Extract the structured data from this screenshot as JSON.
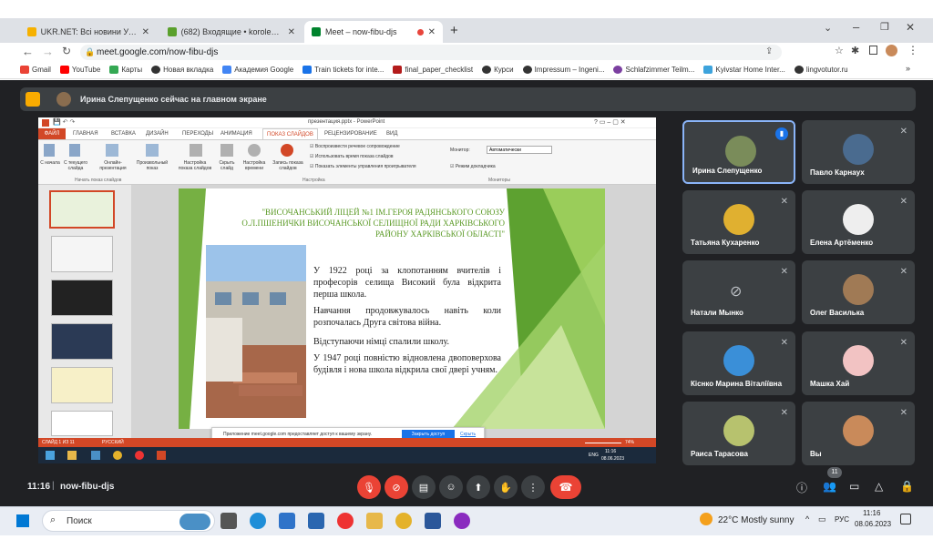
{
  "browser": {
    "tabs": [
      {
        "title": "UKR.NET: Всі новини України, о"
      },
      {
        "title": "(682) Входящие • koroleva-nv7!"
      },
      {
        "title": "Meet – now-fibu-djs"
      }
    ],
    "url": "meet.google.com/now-fibu-djs",
    "bookmarks": [
      "Gmail",
      "YouTube",
      "Карты",
      "Новая вкладка",
      "Академия Google",
      "Train tickets for inte...",
      "final_paper_checklist",
      "Курси",
      "Impressum – Ingeni...",
      "Schlafzimmer Teilm...",
      "Kyivstar Home Inter...",
      "lingvotutor.ru"
    ]
  },
  "meet": {
    "banner": "Ирина Слепущенко сейчас на главном экране",
    "meeting_time": "11:16",
    "meeting_code": "now-fibu-djs",
    "participants_count": "11",
    "participants": [
      {
        "name": "Ирина Слепущенко"
      },
      {
        "name": "Павло Карнаух"
      },
      {
        "name": "Татьяна Кухаренко"
      },
      {
        "name": "Елена Артёменко"
      },
      {
        "name": "Натали Мынко"
      },
      {
        "name": "Олег Василька"
      },
      {
        "name": "Кiснко Марина Віталіївна"
      },
      {
        "name": "Машка Хай"
      },
      {
        "name": "Раиса Тарасова"
      },
      {
        "name": "Вы"
      }
    ]
  },
  "ppt": {
    "title": "презентация.pptx - PowerPoint",
    "tabs": [
      "ФАЙЛ",
      "ГЛАВНАЯ",
      "ВСТАВКА",
      "ДИЗАЙН",
      "ПЕРЕХОДЫ",
      "АНИМАЦИЯ",
      "ПОКАЗ СЛАЙДОВ",
      "РЕЦЕНЗИРОВАНИЕ",
      "ВИД"
    ],
    "ribbon": {
      "btn1": "С начала",
      "btn2": "С текущего слайда",
      "btn3": "Онлайн-презентация",
      "btn4": "Произвольный показ",
      "group1": "Начать показ слайдов",
      "btn5": "Настройка показа слайдов",
      "btn6": "Скрыть слайд",
      "btn7": "Настройка времени",
      "btn8": "Запись показа слайдов",
      "group2": "Настройка",
      "chk1": "Воспроизвести речевое сопровождение",
      "chk2": "Использовать время показа слайдов",
      "chk3": "Показать элементы управления проигрывателя",
      "monitor_label": "Монитор:",
      "monitor_value": "Автоматически",
      "presenter": "Режим докладчика",
      "group3": "Мониторы"
    },
    "slide": {
      "heading": "\"ВИСОЧАНСЬКИЙ ЛІЦЕЙ №1 ІМ.ГЕРОЯ РАДЯНСЬКОГО СОЮЗУ О.Л.ПШЕНИЧКИ ВИСОЧАНСЬКОЇ СЕЛИЩНОЇ РАДИ ХАРКІВСЬКОГО РАЙОНУ ХАРКІВСЬКОЇ ОБЛАСТІ\"",
      "p1": "У 1922 році за клопотанням вчителів і професорів селища Високий була відкрита перша школа.",
      "p2": "Навчання продовжувалось навіть коли розпочалась Друга світова війна.",
      "p3": "Відступаючи німці спалили школу.",
      "p4": "У 1947 році повністю відновлена двоповерхова будівля і нова школа відкрила свої двері учням."
    },
    "status": "СЛАЙД 1 ИЗ 11",
    "lang": "РУССКИЙ",
    "zoom": "74%",
    "share_notice": "Приложение meet.google.com предоставляет доступ к вашему экрану.",
    "share_stop": "Закрыть доступ",
    "share_hide": "Скрыть",
    "inner_time": "11:16",
    "inner_date": "08.06.2023",
    "inner_lang": "ENG"
  },
  "taskbar": {
    "search": "Поиск",
    "weather": "22°C  Mostly sunny",
    "lang": "РУС",
    "time": "11:16",
    "date": "08.06.2023"
  },
  "colors": {
    "meet_bg": "#202124",
    "tile": "#3c4043",
    "end_call": "#ea4335",
    "ppt_red": "#d24726",
    "slide_green": "#5da130"
  }
}
